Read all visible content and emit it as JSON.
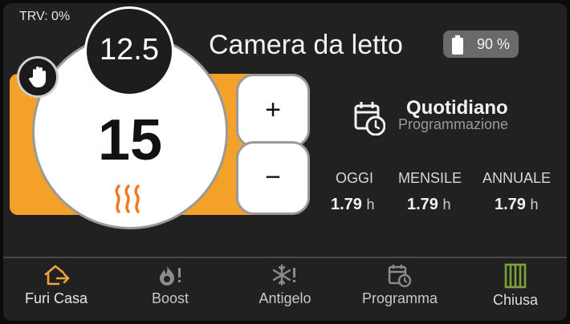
{
  "trv": "TRV: 0%",
  "room": {
    "name": "Camera da letto"
  },
  "battery": {
    "label": "90 %",
    "level_percent": 90
  },
  "thermostat": {
    "current": "12.5",
    "target": "15",
    "plus_label": "+",
    "minus_label": "−",
    "mode_icon": "hand-icon",
    "heating_icon": "flame-icon"
  },
  "schedule": {
    "mode": "Quotidiano",
    "label": "Programmazione",
    "icon": "calendar-clock-icon"
  },
  "stats": [
    {
      "label": "OGGI",
      "value": "1.79",
      "unit": "h"
    },
    {
      "label": "MENSILE",
      "value": "1.79",
      "unit": "h"
    },
    {
      "label": "ANNUALE",
      "value": "1.79",
      "unit": "h"
    }
  ],
  "nav": [
    {
      "label": "Furi Casa",
      "icon": "home-exit-icon",
      "color": "#f2a43a"
    },
    {
      "label": "Boost",
      "icon": "fire-alert-icon",
      "color": "#8c8c8c"
    },
    {
      "label": "Antigelo",
      "icon": "snowflake-alert-icon",
      "color": "#8c8c8c"
    },
    {
      "label": "Programma",
      "icon": "calendar-clock-icon",
      "color": "#8c8c8c"
    },
    {
      "label": "Chiusa",
      "icon": "window-closed-icon",
      "color": "#7aa33a"
    }
  ],
  "colors": {
    "accent": "#f4a12a",
    "card": "#212121",
    "chiusa": "#7aa33a"
  }
}
